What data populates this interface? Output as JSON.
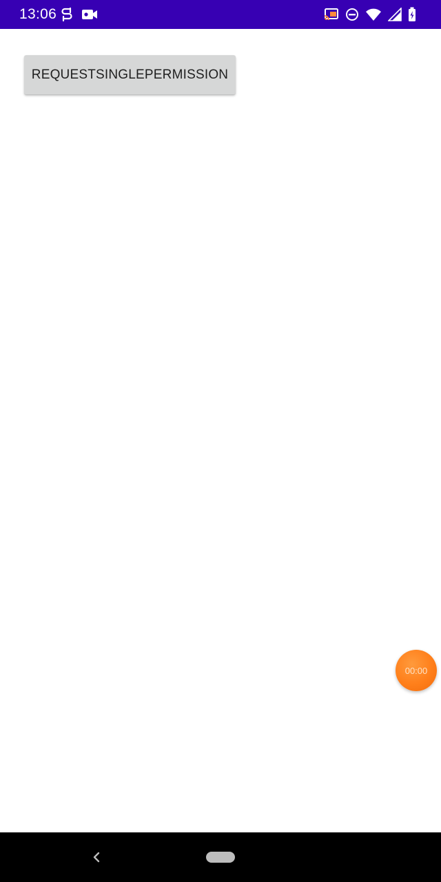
{
  "status_bar": {
    "time": "13:06",
    "left_icons": [
      "sync-status-icon",
      "video-record-icon"
    ],
    "right_icons": [
      "cast-icon",
      "do-not-disturb-icon",
      "wifi-icon",
      "signal-icon",
      "battery-icon"
    ],
    "background_color": "#3700b3"
  },
  "main": {
    "request_button_label": "REQUESTSINGLEPERMISSION"
  },
  "timer_bubble": {
    "label": "00:00",
    "color": "#ff7f1a"
  },
  "nav_bar": {
    "icons": [
      "back-icon",
      "home-pill-icon"
    ]
  }
}
